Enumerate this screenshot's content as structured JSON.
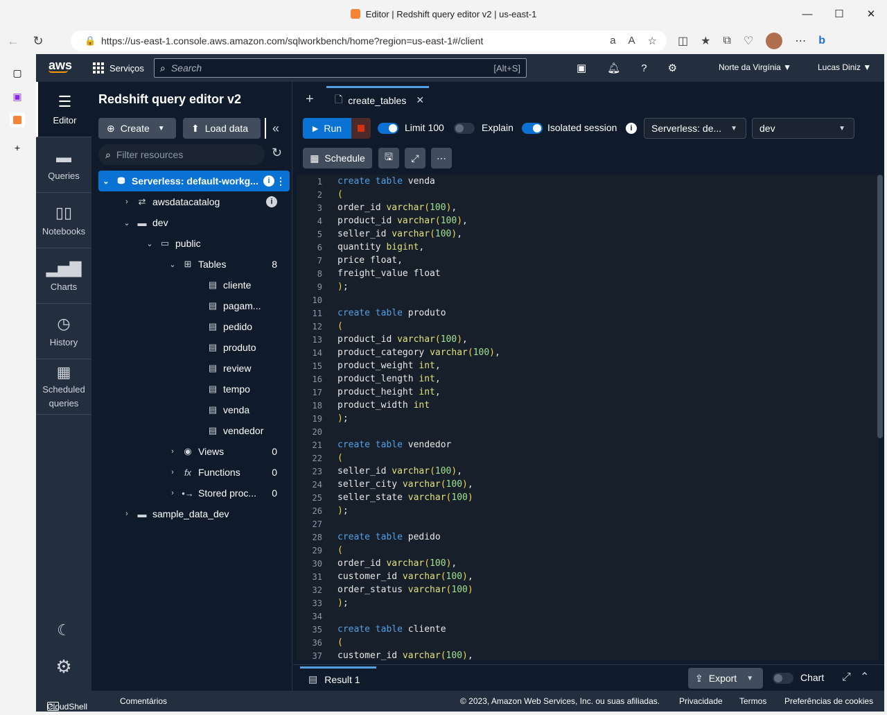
{
  "browser": {
    "title": "Editor | Redshift query editor v2 | us-east-1",
    "url": "https://us-east-1.console.aws.amazon.com/sqlworkbench/home?region=us-east-1#/client"
  },
  "aws": {
    "logo": "aws",
    "services_label": "Serviços",
    "search_placeholder": "Search",
    "search_shortcut": "[Alt+S]",
    "region": "Norte da Virgínia ▼",
    "user": "Lucas Diniz ▼"
  },
  "leftnav": {
    "editor": "Editor",
    "queries": "Queries",
    "notebooks": "Notebooks",
    "charts": "Charts",
    "history": "History",
    "scheduled": "Scheduled queries"
  },
  "resources": {
    "title": "Redshift query editor v2",
    "create_label": "Create",
    "load_data_label": "Load data",
    "filter_placeholder": "Filter resources",
    "tree": [
      {
        "label": "Serverless: default-workg...",
        "count": ""
      },
      {
        "label": "awsdatacatalog",
        "count": ""
      },
      {
        "label": "dev",
        "count": ""
      },
      {
        "label": "public",
        "count": ""
      },
      {
        "label": "Tables",
        "count": "8"
      },
      {
        "label": "cliente",
        "count": ""
      },
      {
        "label": "pagam...",
        "count": ""
      },
      {
        "label": "pedido",
        "count": ""
      },
      {
        "label": "produto",
        "count": ""
      },
      {
        "label": "review",
        "count": ""
      },
      {
        "label": "tempo",
        "count": ""
      },
      {
        "label": "venda",
        "count": ""
      },
      {
        "label": "vendedor",
        "count": ""
      },
      {
        "label": "Views",
        "count": "0"
      },
      {
        "label": "Functions",
        "count": "0"
      },
      {
        "label": "Stored proc...",
        "count": "0"
      },
      {
        "label": "sample_data_dev",
        "count": ""
      }
    ]
  },
  "editor": {
    "tab_label": "create_tables",
    "run_label": "Run",
    "limit_label": "Limit 100",
    "explain_label": "Explain",
    "isolated_label": "Isolated session",
    "workgroup_select": "Serverless: de...",
    "database_select": "dev",
    "schedule_label": "Schedule",
    "result_tab": "Result 1",
    "export_label": "Export",
    "chart_label": "Chart"
  },
  "footer": {
    "cloudshell": "CloudShell",
    "comments": "Comentários",
    "copyright": "© 2023, Amazon Web Services, Inc. ou suas afiliadas.",
    "privacy": "Privacidade",
    "terms": "Termos",
    "cookies": "Preferências de cookies"
  },
  "colors": {
    "accent": "#0972d3",
    "nav_bg": "#232f3e",
    "app_bg": "#0f1b2a",
    "aws_orange": "#ff9900"
  }
}
